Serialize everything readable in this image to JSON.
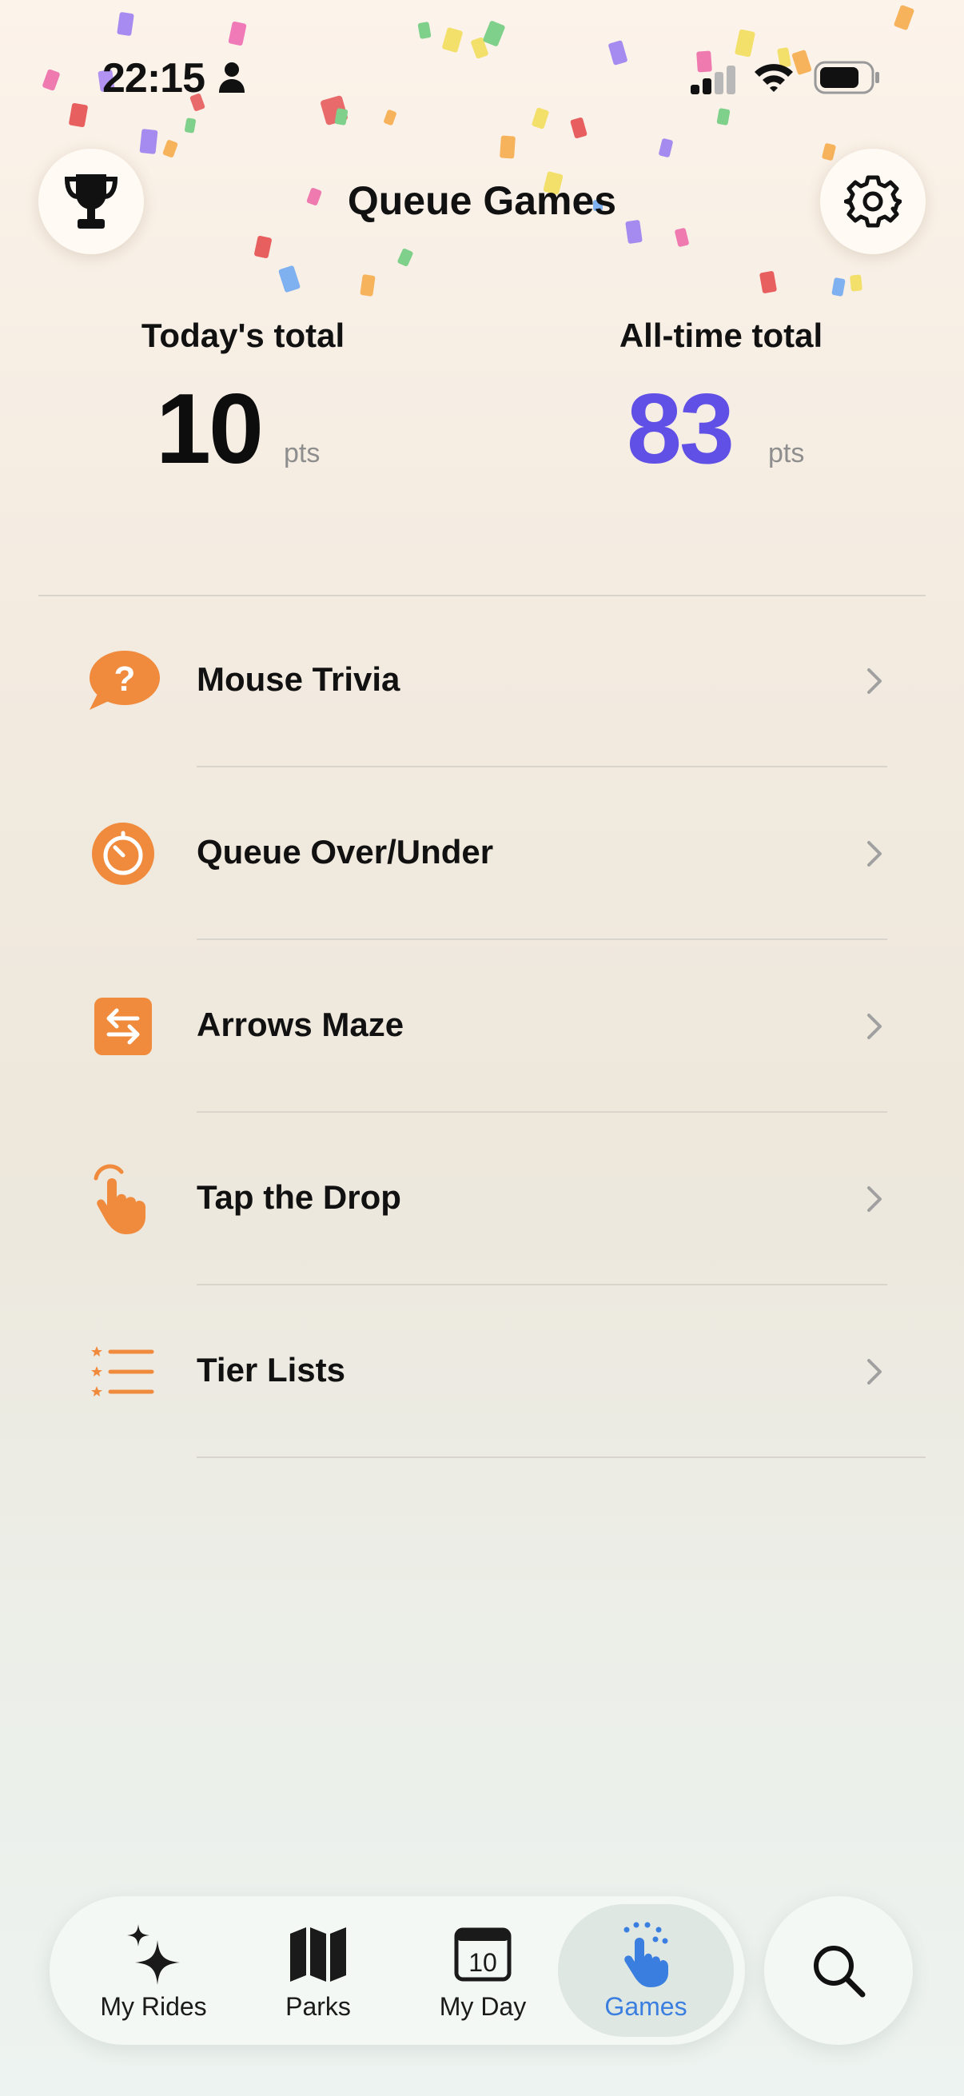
{
  "status_bar": {
    "time": "22:15"
  },
  "header": {
    "title": "Queue Games"
  },
  "totals": {
    "today_label": "Today's total",
    "today_value": "10",
    "today_unit": "pts",
    "alltime_label": "All-time total",
    "alltime_value": "83",
    "alltime_unit": "pts"
  },
  "games": [
    {
      "label": "Mouse Trivia",
      "icon": "trivia-bubble-icon"
    },
    {
      "label": "Queue Over/Under",
      "icon": "timer-icon"
    },
    {
      "label": "Arrows Maze",
      "icon": "arrows-swap-icon"
    },
    {
      "label": "Tap the Drop",
      "icon": "tap-hand-icon"
    },
    {
      "label": "Tier Lists",
      "icon": "star-list-icon"
    }
  ],
  "tabbar": {
    "tabs": [
      {
        "label": "My Rides",
        "icon": "sparkles-icon"
      },
      {
        "label": "Parks",
        "icon": "map-icon"
      },
      {
        "label": "My Day",
        "icon": "calendar-icon",
        "calendar_day": "10"
      },
      {
        "label": "Games",
        "icon": "tap-hand-icon",
        "active": true
      }
    ]
  },
  "colors": {
    "accent_orange": "#f08a3c",
    "alltime_purple": "#6150e6",
    "active_tab_blue": "#3a7ee0"
  }
}
